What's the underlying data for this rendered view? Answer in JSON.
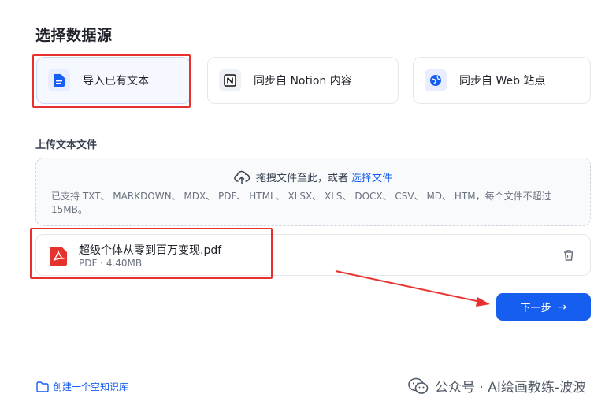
{
  "page": {
    "title": "选择数据源"
  },
  "sources": [
    {
      "label": "导入已有文本",
      "icon": "document-icon",
      "selected": true
    },
    {
      "label": "同步自 Notion 内容",
      "icon": "notion-icon",
      "selected": false
    },
    {
      "label": "同步自 Web 站点",
      "icon": "web-icon",
      "selected": false
    }
  ],
  "upload": {
    "section_label": "上传文本文件",
    "drop_text": "拖拽文件至此，或者",
    "drop_link": "选择文件",
    "hint": "已支持 TXT、 MARKDOWN、 MDX、 PDF、 HTML、 XLSX、 XLS、 DOCX、 CSV、 MD、 HTM，每个文件不超过 15MB。"
  },
  "file": {
    "name": "超级个体从零到百万变现.pdf",
    "meta": "PDF · 4.40MB"
  },
  "actions": {
    "next_label": "下一步",
    "next_arrow": "→"
  },
  "footer": {
    "create_link": "创建一个空知识库",
    "watermark": "公众号 · AI绘画教练-波波"
  },
  "colors": {
    "accent": "#155eef",
    "annotation": "#e8312f",
    "pdf": "#e5322d"
  }
}
